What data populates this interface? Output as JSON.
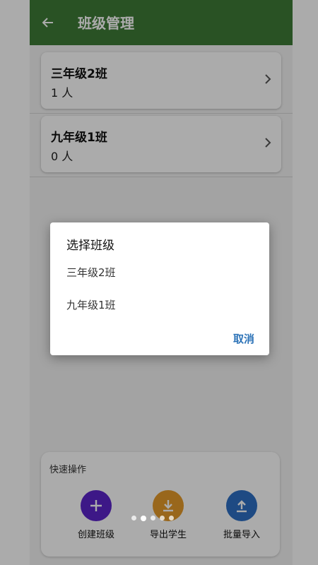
{
  "appbar": {
    "title": "班级管理",
    "back_icon": "arrow-left-icon"
  },
  "classes": [
    {
      "name": "三年级2班",
      "count": "1 人"
    },
    {
      "name": "九年级1班",
      "count": "0 人"
    }
  ],
  "quick_actions": {
    "title": "快速操作",
    "items": [
      {
        "label": "创建班级",
        "icon": "plus-icon",
        "color": "#5b24c9"
      },
      {
        "label": "导出学生",
        "icon": "download-icon",
        "color": "#e59a2b"
      },
      {
        "label": "批量导入",
        "icon": "upload-icon",
        "color": "#2d6fc4"
      }
    ]
  },
  "dialog": {
    "title": "选择班级",
    "options": [
      "三年级2班",
      "九年级1班"
    ],
    "cancel_label": "取消"
  },
  "colors": {
    "appbar": "#3e7b36",
    "accent": "#2e74b8"
  }
}
